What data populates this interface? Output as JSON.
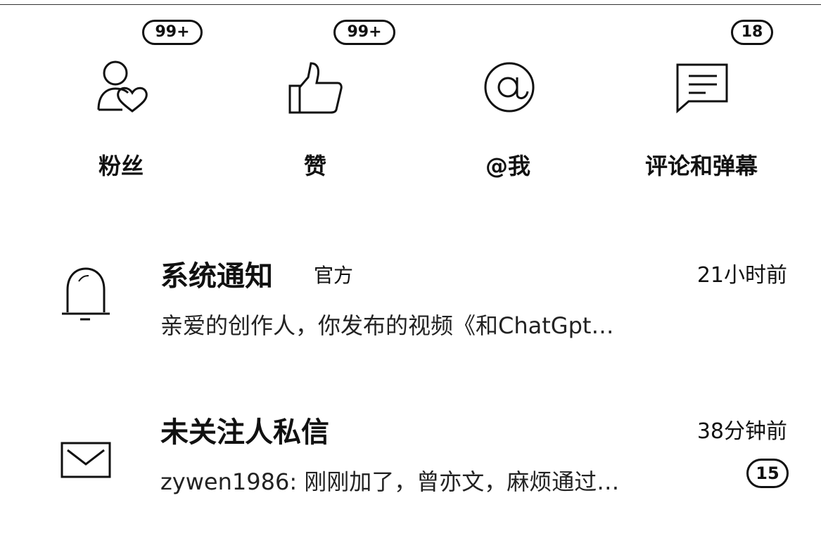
{
  "categories": [
    {
      "label": "粉丝",
      "badge": "99+",
      "icon": "fans-heart-icon"
    },
    {
      "label": "赞",
      "badge": "99+",
      "icon": "thumbs-up-icon"
    },
    {
      "label": "@我",
      "badge": "",
      "icon": "at-sign-icon"
    },
    {
      "label": "评论和弹幕",
      "badge": "18",
      "icon": "comment-bubble-icon"
    }
  ],
  "messages": [
    {
      "title": "系统通知",
      "tag": "官方",
      "time": "21小时前",
      "preview": "亲爱的创作人，你发布的视频《和ChatGpt…",
      "icon": "bell-icon",
      "badge": ""
    },
    {
      "title": "未关注人私信",
      "tag": "",
      "time": "38分钟前",
      "preview": "zywen1986: 刚刚加了，曾亦文，麻烦通过…",
      "icon": "envelope-icon",
      "badge": "15"
    }
  ]
}
